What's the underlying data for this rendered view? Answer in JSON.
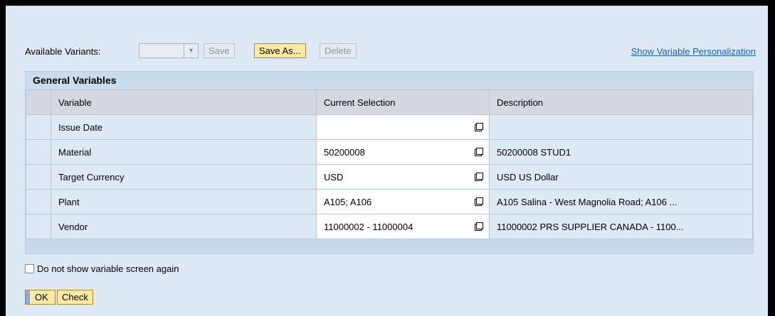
{
  "toolbar": {
    "available_variants_label": "Available Variants:",
    "variant_value": "",
    "save_label": "Save",
    "save_as_label": "Save As...",
    "delete_label": "Delete",
    "personalization_link": "Show Variable Personalization"
  },
  "variables_panel": {
    "title": "General Variables",
    "columns": [
      "Variable",
      "Current Selection",
      "Description"
    ],
    "rows": [
      {
        "variable": "Issue Date",
        "selection": "",
        "description": ""
      },
      {
        "variable": "Material",
        "selection": "50200008",
        "description": "50200008 STUD1"
      },
      {
        "variable": "Target Currency",
        "selection": "USD",
        "description": "USD US Dollar"
      },
      {
        "variable": "Plant",
        "selection": "A105; A106",
        "description": "A105 Salina - West Magnolia Road; A106 ..."
      },
      {
        "variable": "Vendor",
        "selection": "11000002 - 11000004",
        "description": "11000002 PRS SUPPLIER CANADA - 1100..."
      }
    ]
  },
  "options": {
    "do_not_show_label": "Do not show variable screen again",
    "do_not_show_checked": false
  },
  "actions": {
    "ok_label": "OK",
    "check_label": "Check"
  },
  "colors": {
    "panel_bg": "#dfe9f5",
    "header_bg": "#c9dcee",
    "active_button": "#fde9a2",
    "link": "#1f5fa8"
  }
}
